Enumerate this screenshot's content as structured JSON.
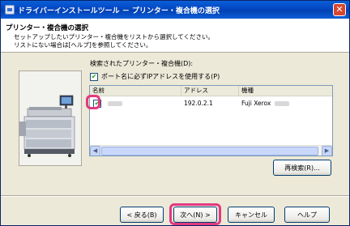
{
  "window": {
    "title": "ドライバーインストールツール － プリンター・複合機の選択",
    "close_glyph": "✕"
  },
  "header": {
    "title": "プリンター・複合機の選択",
    "desc_line1": "セットアップしたいプリンター・複合機をリストから選択してください。",
    "desc_line2": "リストにない場合は[ヘルプ]を参照してください。"
  },
  "main": {
    "group_label": "検索されたプリンター・複合機(D):",
    "use_ip_checkbox": {
      "label": "ポート名に必ずIPアドレスを使用する(P)",
      "checked": true
    },
    "list": {
      "columns": [
        "名前",
        "アドレス",
        "機種"
      ],
      "rows": [
        {
          "checked": true,
          "name": "",
          "address": "192.0.2.1",
          "model": "Fuji Xerox"
        }
      ]
    },
    "rescan_label": "再検索(R)..."
  },
  "footer": {
    "back_label": "< 戻る(B)",
    "next_label": "次へ(N) >",
    "cancel_label": "キャンセル",
    "help_label": "ヘルプ"
  },
  "icons": {
    "check": "✔",
    "left_arrow": "◀",
    "right_arrow": "▶"
  },
  "colors": {
    "title_bar": "#0a5fd8",
    "highlight": "#e3397f",
    "check_green": "#21a121"
  }
}
